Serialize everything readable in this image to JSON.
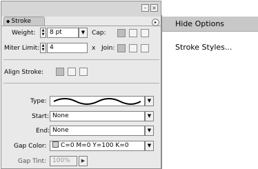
{
  "panel": {
    "title": "Stroke",
    "weight_label": "Weight:",
    "weight_value": "8 pt",
    "cap_label": "Cap:",
    "miter_label": "Miter Limit:",
    "miter_value": "4",
    "miter_unit": "x",
    "join_label": "Join:",
    "align_label": "Align Stroke:",
    "type_label": "Type:",
    "start_label": "Start:",
    "start_value": "None",
    "end_label": "End:",
    "end_value": "None",
    "gap_color_label": "Gap Color:",
    "gap_color_value": "C=0 M=0 Y=100 K=0",
    "gap_tint_label": "Gap Tint:",
    "gap_tint_value": "100%"
  },
  "menu": {
    "items": [
      "Hide Options",
      "Stroke Styles..."
    ]
  }
}
